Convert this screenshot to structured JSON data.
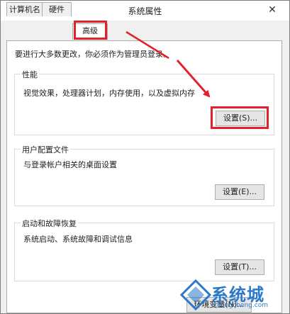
{
  "window": {
    "title": "系统属性",
    "close_glyph": "✕"
  },
  "tabs": [
    {
      "label": "计算机名"
    },
    {
      "label": "硬件"
    },
    {
      "label": "高级"
    }
  ],
  "active_tab": "高级",
  "intro_text": "要进行大多数更改，你必须作为管理员登录。",
  "groups": {
    "performance": {
      "title": "性能",
      "description": "视觉效果，处理器计划，内存使用，以及虚拟内存",
      "button": "设置(S)..."
    },
    "user_profiles": {
      "title": "用户配置文件",
      "description": "与登录帐户相关的桌面设置",
      "button": "设置(E)..."
    },
    "startup_recovery": {
      "title": "启动和故障恢复",
      "description": "系统启动、系统故障和调试信息",
      "button": "设置(T)..."
    }
  },
  "bottom_button": "环境变量(N)...",
  "annotation": {
    "color": "#e0232b"
  },
  "watermark": {
    "brand": "系统城",
    "url": "xitongcheng.com",
    "color": "#2b79c9"
  }
}
